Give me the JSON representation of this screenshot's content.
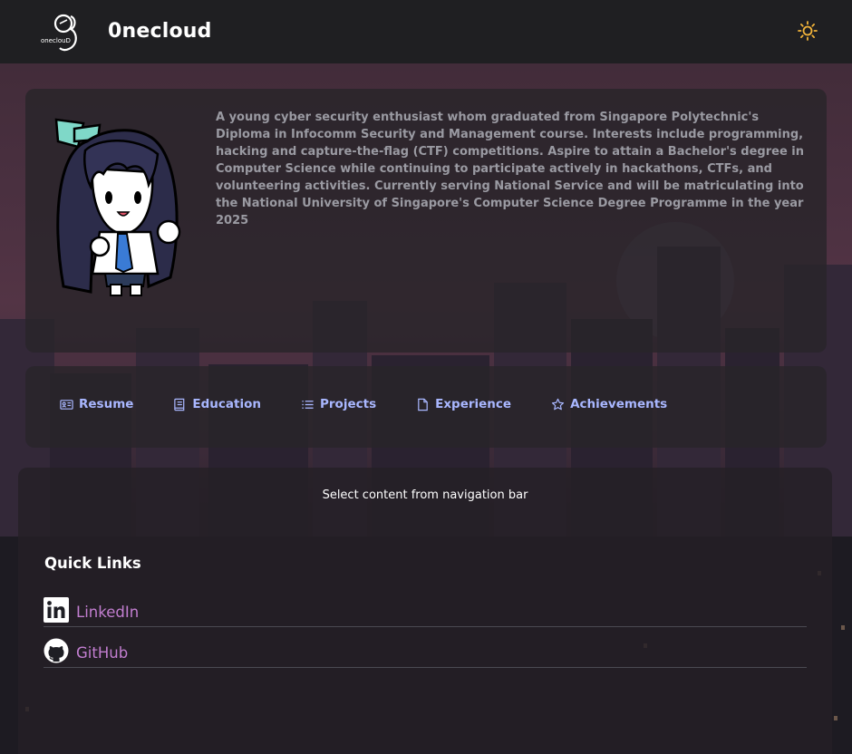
{
  "header": {
    "logo_text": "oneclouD",
    "brand": "0necloud",
    "theme_icon": "sun-icon"
  },
  "about": {
    "avatar": "chibi-character-avatar",
    "bio": "A young cyber security enthusiast whom graduated from Singapore Polytechnic's Diploma in Infocomm Security and Management course. Interests include programming, hacking and capture-the-flag (CTF) competitions. Aspire to attain a Bachelor's degree in Computer Science while continuing to participate actively in hackathons, CTFs, and volunteering activities. Currently serving National Service and will be matriculating into the National University of Singapore's Computer Science Degree Programme in the year 2025"
  },
  "nav": {
    "items": [
      {
        "label": "Resume",
        "icon": "id-card-icon"
      },
      {
        "label": "Education",
        "icon": "book-icon"
      },
      {
        "label": "Projects",
        "icon": "list-icon"
      },
      {
        "label": "Experience",
        "icon": "file-icon"
      },
      {
        "label": "Achievements",
        "icon": "star-icon"
      }
    ],
    "color": "#a9b7ff"
  },
  "content": {
    "hint": "Select content from navigation bar"
  },
  "quick_links": {
    "title": "Quick Links",
    "items": [
      {
        "label": "LinkedIn",
        "icon": "linkedin-icon"
      },
      {
        "label": "GitHub",
        "icon": "github-icon"
      }
    ],
    "link_color": "#c27ed0"
  }
}
